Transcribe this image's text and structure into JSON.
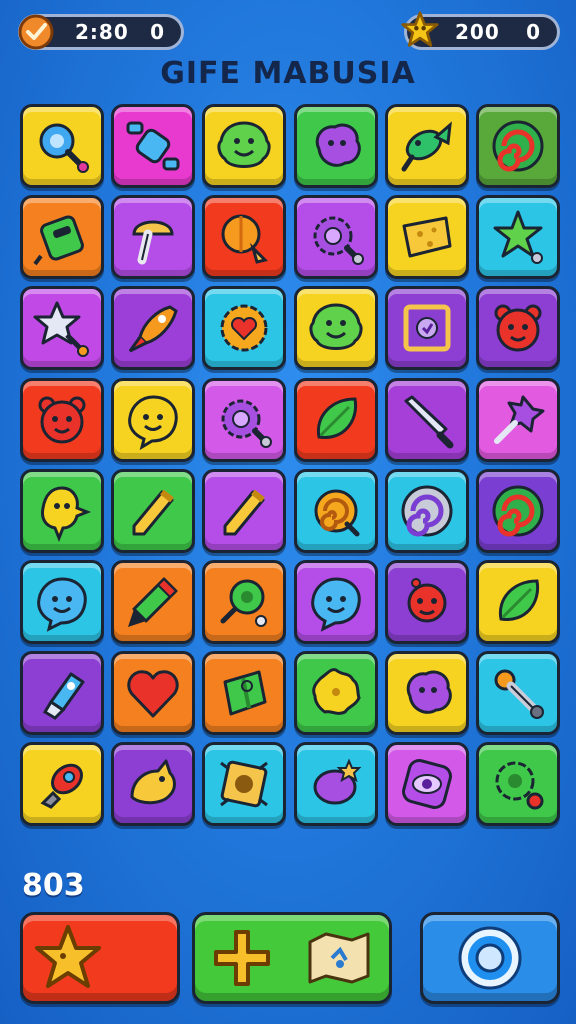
{
  "hud": {
    "left_value": "2:80",
    "left_count": "0",
    "right_value": "200",
    "right_count": "0",
    "colors": {
      "pill_bg": "#1e2a44",
      "coin": "#f0892a",
      "star": "#f5c518"
    }
  },
  "title": "GIFE MABUSIA",
  "score": "803",
  "board": {
    "rows": 8,
    "cols": 6,
    "tiles": [
      {
        "color": "#f7d321",
        "icon": "blue-lollipop-icon"
      },
      {
        "color": "#e93ad0",
        "icon": "blue-candy-icon"
      },
      {
        "color": "#f7d321",
        "icon": "green-monster-icon"
      },
      {
        "color": "#3fc84a",
        "icon": "purple-blob-icon"
      },
      {
        "color": "#f7d321",
        "icon": "green-fish-icon"
      },
      {
        "color": "#58a83a",
        "icon": "swirl-candy-icon"
      },
      {
        "color": "#f4801f",
        "icon": "green-robot-icon"
      },
      {
        "color": "#b54ee8",
        "icon": "mushroom-icon"
      },
      {
        "color": "#f23a1e",
        "icon": "orange-lollipop-icon"
      },
      {
        "color": "#b54ee8",
        "icon": "purple-gear-icon"
      },
      {
        "color": "#f7d321",
        "icon": "cheese-icon"
      },
      {
        "color": "#2cc5e6",
        "icon": "green-star-icon"
      },
      {
        "color": "#c14ae6",
        "icon": "silver-star-icon"
      },
      {
        "color": "#9b3fd8",
        "icon": "orange-rocket-icon"
      },
      {
        "color": "#2cc5e6",
        "icon": "heart-gear-icon"
      },
      {
        "color": "#f7d321",
        "icon": "green-monster-icon"
      },
      {
        "color": "#8c3fd2",
        "icon": "purple-frame-icon"
      },
      {
        "color": "#8c3fd2",
        "icon": "red-bear-icon"
      },
      {
        "color": "#f23a1e",
        "icon": "red-bear-icon"
      },
      {
        "color": "#f7d321",
        "icon": "yellow-smiley-icon"
      },
      {
        "color": "#d35ae8",
        "icon": "purple-gear-icon"
      },
      {
        "color": "#f23a1e",
        "icon": "green-leaf-icon"
      },
      {
        "color": "#a63fd8",
        "icon": "knife-icon"
      },
      {
        "color": "#e25ae0",
        "icon": "purple-pin-icon"
      },
      {
        "color": "#3fc84a",
        "icon": "yellow-chick-icon"
      },
      {
        "color": "#3fc84a",
        "icon": "yellow-crayon-icon"
      },
      {
        "color": "#b54ee8",
        "icon": "yellow-crayon-icon"
      },
      {
        "color": "#2cc5e6",
        "icon": "orange-swirl-icon"
      },
      {
        "color": "#2cc5e6",
        "icon": "silver-swirl-icon"
      },
      {
        "color": "#7a3fd2",
        "icon": "swirl-candy-icon"
      },
      {
        "color": "#2cc5e6",
        "icon": "blue-smiley-icon"
      },
      {
        "color": "#f4801f",
        "icon": "green-marker-icon"
      },
      {
        "color": "#f4801f",
        "icon": "green-lollipop-icon"
      },
      {
        "color": "#b54ee8",
        "icon": "blue-smiley-icon"
      },
      {
        "color": "#8c3fd2",
        "icon": "red-bug-icon"
      },
      {
        "color": "#f7d321",
        "icon": "green-leaf-icon"
      },
      {
        "color": "#8c3fd2",
        "icon": "blue-bottle-icon"
      },
      {
        "color": "#f4801f",
        "icon": "red-heart-icon"
      },
      {
        "color": "#f4801f",
        "icon": "green-gift-icon"
      },
      {
        "color": "#3fc84a",
        "icon": "yellow-splat-icon"
      },
      {
        "color": "#f7d321",
        "icon": "purple-blob-icon"
      },
      {
        "color": "#2cc5e6",
        "icon": "wrench-icon"
      },
      {
        "color": "#f7d321",
        "icon": "red-rocket-icon"
      },
      {
        "color": "#8c3fd2",
        "icon": "yellow-bird-icon"
      },
      {
        "color": "#2cc5e6",
        "icon": "gold-frame-icon"
      },
      {
        "color": "#2cc5e6",
        "icon": "purple-plum-icon"
      },
      {
        "color": "#d35ae8",
        "icon": "purple-eye-icon"
      },
      {
        "color": "#3fc84a",
        "icon": "green-gear-icon"
      }
    ]
  },
  "buttons": {
    "left": {
      "color": "#f23a1e",
      "icon": "gold-star-icon"
    },
    "center": {
      "color": "#44c93a",
      "icons": [
        "gold-plus-icon",
        "map-scroll-icon"
      ]
    },
    "right": {
      "color": "#2a8de8",
      "icon": "blue-ring-icon"
    }
  }
}
